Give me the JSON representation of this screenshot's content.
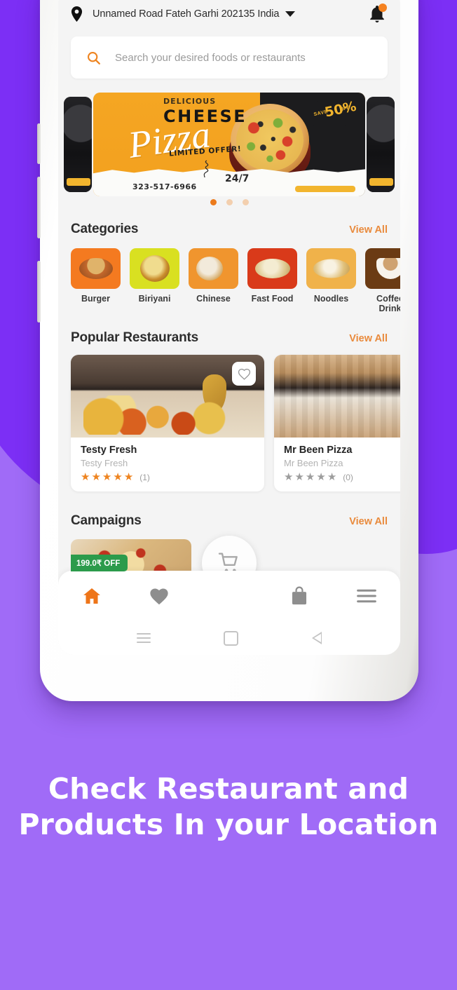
{
  "theme": {
    "purple_dark": "#7C2FF5",
    "purple_light": "#A06BF7",
    "accent_orange": "#EE8420",
    "view_all_orange": "#E98A3C",
    "badge_green": "#2C9B4B"
  },
  "header": {
    "location_icon": "map-pin-icon",
    "location": "Unnamed Road Fateh Garhi 202135 India",
    "dropdown_icon": "chevron-down-icon",
    "notification_icon": "bell-icon",
    "has_notification_dot": true
  },
  "search": {
    "icon": "search-icon",
    "placeholder": "Search your desired foods or restaurants",
    "value": ""
  },
  "banner": {
    "deliciousLabel": "DELICIOUS",
    "cheeseLabel": "CHEESE",
    "pizzaLabel": "Pizza",
    "limitedLabel": "LIMITED OFFER!",
    "phone": "323-517-6966",
    "hours": "24/7",
    "badge_save": "SAVE",
    "badge_percent": "50%",
    "badge_off": "OFF",
    "dots": [
      {
        "active": true
      },
      {
        "active": false
      },
      {
        "active": false
      }
    ]
  },
  "categories": {
    "title": "Categories",
    "view_all": "View All",
    "items": [
      {
        "label": "Burger",
        "tile_color": "#F47A20",
        "food_color": "#C8763A"
      },
      {
        "label": "Biriyani",
        "tile_color": "#D9E021",
        "food_color": "#D9A32A"
      },
      {
        "label": "Chinese",
        "tile_color": "#F0952E",
        "food_color": "#E2D3B0"
      },
      {
        "label": "Fast Food",
        "tile_color": "#D93A1A",
        "food_color": "#E8DFB8"
      },
      {
        "label": "Noodles",
        "tile_color": "#F0B24A",
        "food_color": "#F2E6C8"
      },
      {
        "label": "Coffee Drink",
        "tile_color": "#6B3B14",
        "food_color": "#F5EFE4"
      }
    ]
  },
  "popular_restaurants": {
    "title": "Popular Restaurants",
    "view_all": "View All",
    "favorite_icon": "heart-outline-icon",
    "items": [
      {
        "name": "Testy Fresh",
        "subtitle": "Testy Fresh",
        "rating": 5,
        "rating_count": "(1)",
        "has_favorite_button": true
      },
      {
        "name": "Mr Been Pizza",
        "subtitle": "Mr Been Pizza",
        "rating": 0,
        "rating_count": "(0)",
        "has_favorite_button": false
      }
    ]
  },
  "campaigns": {
    "title": "Campaigns",
    "view_all": "View All",
    "items": [
      {
        "badge": "199.0₹ OFF"
      }
    ]
  },
  "bottom_nav": {
    "items": [
      {
        "icon": "home-icon",
        "active": true
      },
      {
        "icon": "heart-icon",
        "active": false
      },
      {
        "icon": "shopping-bag-icon",
        "active": false
      },
      {
        "icon": "menu-icon",
        "active": false
      }
    ],
    "fab_icon": "cart-icon"
  },
  "system_nav": {
    "recents_icon": "recents-icon",
    "home_icon": "home-square-icon",
    "back_icon": "back-triangle-icon"
  },
  "caption": {
    "line1": "Check  Restaurant and",
    "line2": "Products In your Location"
  }
}
